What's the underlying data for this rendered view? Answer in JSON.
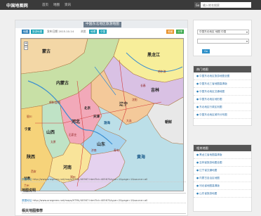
{
  "nav": {
    "logo": "中国地图网",
    "links": [
      "首页",
      "地图",
      "资讯"
    ],
    "search_button": "Go",
    "search_placeholder": "输入地名搜索"
  },
  "article": {
    "title": "中国东北地区旅游地图",
    "tags": [
      {
        "label": "地图",
        "color": "blue"
      },
      {
        "label": "旅游地图",
        "color": "teal"
      }
    ],
    "date": "发布日期 2015.10.14",
    "views": "浏览",
    "author_tags": [
      {
        "label": "地理",
        "color": "teal"
      },
      {
        "label": "中国",
        "color": "teal"
      }
    ],
    "right_tags": [
      {
        "label": "收藏",
        "color": "orange"
      },
      {
        "label": "分享",
        "color": "green"
      }
    ],
    "links": [
      {
        "prefix": "原图地址",
        "url": "http://www.onegreen.net/maps/HTML/40567.html?id=40567&type=1&page=1&source=all"
      },
      {
        "prefix": "原图地址",
        "url": "http://www.onegreen.net/maps/HTML/40567.html?id=40567&type=2&page=1&source=all"
      }
    ],
    "sections": [
      "地图说明",
      "相关地图推荐"
    ]
  },
  "map": {
    "labels": [
      "黑龙江",
      "吉林",
      "辽宁",
      "内蒙古",
      "河北",
      "北京",
      "天津",
      "山东",
      "山西",
      "河南",
      "陕西",
      "宁夏",
      "甘肃",
      "渤海",
      "黄海",
      "朝鲜",
      "蒙古",
      "哈尔滨",
      "长春",
      "沈阳",
      "大连",
      "呼和浩特",
      "石家庄",
      "太原",
      "济南",
      "郑州",
      "西安",
      "银川",
      "兰州",
      "青岛"
    ]
  },
  "sidebar": {
    "select1": "中国东北地区 地图 中国",
    "select2": "",
    "go_button": "Go",
    "box1": {
      "title": "热门地图",
      "items": [
        "中国东北地区旅游地图全图",
        "中国东北三省地图高清版",
        "中国东北地区交通地图",
        "中国东北地区地形图",
        "东北地区行政区划图",
        "中国东北地区城市分布图"
      ]
    },
    "box2": {
      "title": "相关地图",
      "items": [
        "黑龙江省地图高清版",
        "吉林省旅游地图全图",
        "辽宁省交通地图",
        "内蒙古自治区地图",
        "河北省地图高清版",
        "山东省旅游地图"
      ]
    }
  },
  "colors": {
    "nav_bg": "#3a3a3a",
    "accent_blue": "#2d7fb8",
    "sea": "#bcdfe8"
  }
}
